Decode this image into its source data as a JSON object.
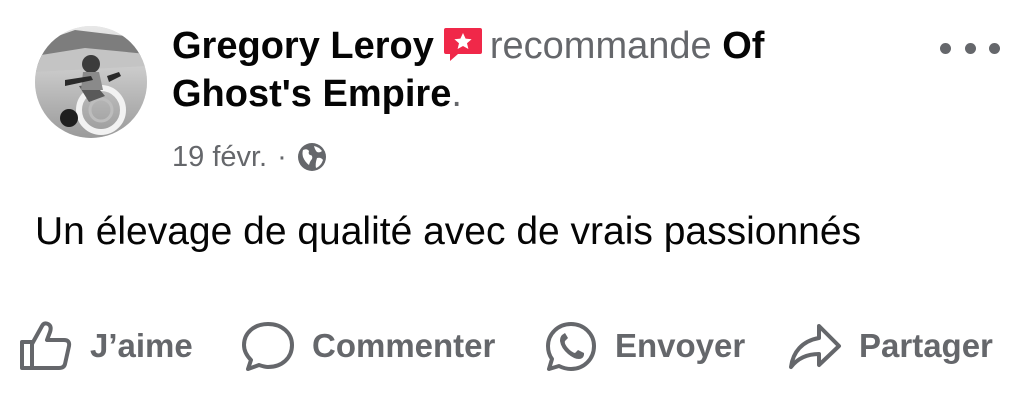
{
  "post": {
    "author": "Gregory Leroy",
    "verb": "recommande",
    "page_name": "Of Ghost's Empire",
    "period": ".",
    "date": "19 févr.",
    "separator": "·",
    "body": "Un élevage de qualité avec de vrais passionnés",
    "privacy_icon": "globe-icon",
    "badge_icon": "recommendation-star-icon"
  },
  "actions": {
    "like_label": "J’aime",
    "comment_label": "Commenter",
    "send_label": "Envoyer",
    "share_label": "Partager"
  },
  "colors": {
    "text_primary": "#050505",
    "text_secondary": "#65676b",
    "badge_red": "#f02849"
  }
}
